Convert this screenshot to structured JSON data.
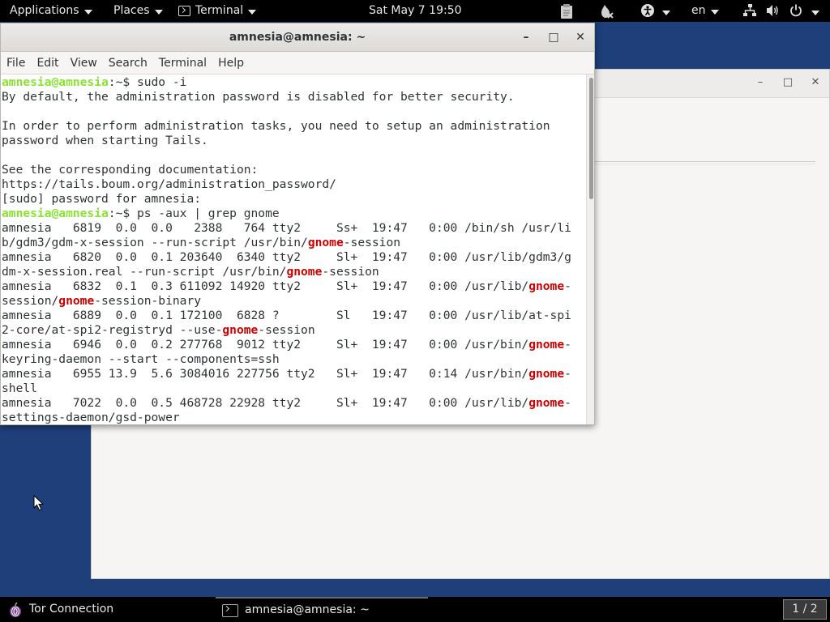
{
  "top_panel": {
    "applications": "Applications",
    "places": "Places",
    "app_menu": "Terminal",
    "clock": "Sat May 7  19:50",
    "language": "en"
  },
  "terminal": {
    "title": "amnesia@amnesia: ~",
    "menu": [
      "File",
      "Edit",
      "View",
      "Search",
      "Terminal",
      "Help"
    ],
    "lines": [
      {
        "segs": [
          {
            "t": "amnesia@amnesia",
            "c": "prompt-user"
          },
          {
            "t": ":~$ sudo -i",
            "c": "prompt-rest"
          }
        ]
      },
      {
        "segs": [
          {
            "t": "By default, the administration password is disabled for better security.",
            "c": ""
          }
        ]
      },
      {
        "segs": [
          {
            "t": "",
            "c": ""
          }
        ]
      },
      {
        "segs": [
          {
            "t": "In order to perform administration tasks, you need to setup an administration",
            "c": ""
          }
        ]
      },
      {
        "segs": [
          {
            "t": "password when starting Tails.",
            "c": ""
          }
        ]
      },
      {
        "segs": [
          {
            "t": "",
            "c": ""
          }
        ]
      },
      {
        "segs": [
          {
            "t": "See the corresponding documentation:",
            "c": ""
          }
        ]
      },
      {
        "segs": [
          {
            "t": "https://tails.boum.org/administration_password/",
            "c": ""
          }
        ]
      },
      {
        "segs": [
          {
            "t": "[sudo] password for amnesia:",
            "c": ""
          }
        ]
      },
      {
        "segs": [
          {
            "t": "amnesia@amnesia",
            "c": "prompt-user"
          },
          {
            "t": ":~$ ps -aux | grep gnome",
            "c": "prompt-rest"
          }
        ]
      },
      {
        "segs": [
          {
            "t": "amnesia   6819  0.0  0.0   2388   764 tty2     Ss+  19:47   0:00 /bin/sh /usr/li",
            "c": ""
          }
        ]
      },
      {
        "segs": [
          {
            "t": "b/gdm3/gdm-x-session --run-script /usr/bin/",
            "c": ""
          },
          {
            "t": "gnome",
            "c": "hl"
          },
          {
            "t": "-session",
            "c": ""
          }
        ]
      },
      {
        "segs": [
          {
            "t": "amnesia   6820  0.0  0.1 203640  6340 tty2     Sl+  19:47   0:00 /usr/lib/gdm3/g",
            "c": ""
          }
        ]
      },
      {
        "segs": [
          {
            "t": "dm-x-session.real --run-script /usr/bin/",
            "c": ""
          },
          {
            "t": "gnome",
            "c": "hl"
          },
          {
            "t": "-session",
            "c": ""
          }
        ]
      },
      {
        "segs": [
          {
            "t": "amnesia   6832  0.1  0.3 611092 14920 tty2     Sl+  19:47   0:00 /usr/lib/",
            "c": ""
          },
          {
            "t": "gnome",
            "c": "hl"
          },
          {
            "t": "-",
            "c": ""
          }
        ]
      },
      {
        "segs": [
          {
            "t": "session/",
            "c": ""
          },
          {
            "t": "gnome",
            "c": "hl"
          },
          {
            "t": "-session-binary",
            "c": ""
          }
        ]
      },
      {
        "segs": [
          {
            "t": "amnesia   6889  0.0  0.1 172100  6828 ?        Sl   19:47   0:00 /usr/lib/at-spi",
            "c": ""
          }
        ]
      },
      {
        "segs": [
          {
            "t": "2-core/at-spi2-registryd --use-",
            "c": ""
          },
          {
            "t": "gnome",
            "c": "hl"
          },
          {
            "t": "-session",
            "c": ""
          }
        ]
      },
      {
        "segs": [
          {
            "t": "amnesia   6946  0.0  0.2 277768  9012 tty2     Sl+  19:47   0:00 /usr/bin/",
            "c": ""
          },
          {
            "t": "gnome",
            "c": "hl"
          },
          {
            "t": "-",
            "c": ""
          }
        ]
      },
      {
        "segs": [
          {
            "t": "keyring-daemon --start --components=ssh",
            "c": ""
          }
        ]
      },
      {
        "segs": [
          {
            "t": "amnesia   6955 13.9  5.6 3084016 227756 tty2   Sl+  19:47   0:14 /usr/bin/",
            "c": ""
          },
          {
            "t": "gnome",
            "c": "hl"
          },
          {
            "t": "-",
            "c": ""
          }
        ]
      },
      {
        "segs": [
          {
            "t": "shell",
            "c": ""
          }
        ]
      },
      {
        "segs": [
          {
            "t": "amnesia   7022  0.0  0.5 468728 22928 tty2     Sl+  19:47   0:00 /usr/lib/",
            "c": ""
          },
          {
            "t": "gnome",
            "c": "hl"
          },
          {
            "t": "-",
            "c": ""
          }
        ]
      },
      {
        "segs": [
          {
            "t": "settings-daemon/gsd-power",
            "c": ""
          }
        ]
      }
    ]
  },
  "bottom_panel": {
    "tor_label": "Tor Connection",
    "task_label": "amnesia@amnesia: ~",
    "workspace": "1 / 2"
  },
  "colors": {
    "desktop": "#1e3f7a",
    "prompt_user": "#8ae234",
    "grep_highlight": "#cc0000"
  },
  "icons": [
    "terminal-icon",
    "clipboard-icon",
    "tor-status-icon",
    "accessibility-icon",
    "network-icon",
    "volume-icon",
    "power-icon",
    "tor-onion-icon",
    "mouse-cursor-icon"
  ]
}
